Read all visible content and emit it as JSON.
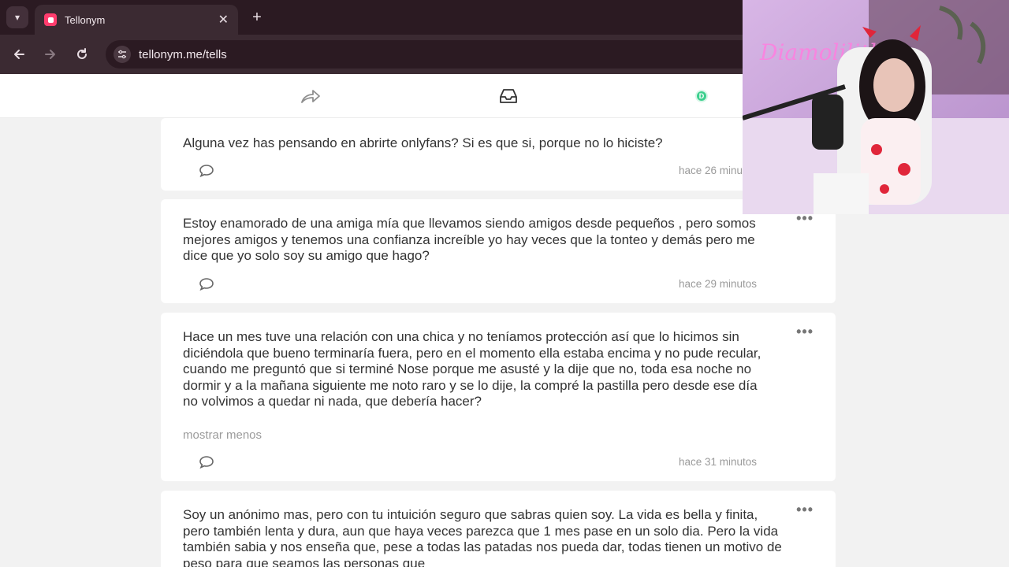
{
  "browser": {
    "tab_title": "Tellonym",
    "tab_close": "✕",
    "new_tab": "+",
    "url": "tellonym.me/tells"
  },
  "header": {
    "profile_initial": "D"
  },
  "tells": [
    {
      "text": "Alguna vez has pensando en abrirte onlyfans? Si es que si, porque no lo hiciste?",
      "time": "hace 26 minutos"
    },
    {
      "text": "Estoy enamorado de una amiga mía que llevamos siendo amigos desde pequeños , pero somos mejores amigos y tenemos una confianza increíble yo hay veces que la tonteo y demás pero me dice que yo solo soy su amigo que hago?",
      "time": "hace 29 minutos",
      "menu": "•••"
    },
    {
      "text": "Hace un mes tuve una relación con una chica y no teníamos protección así que lo hicimos sin diciéndola que bueno terminaría fuera, pero en el momento ella estaba encima y no pude recular, cuando me preguntó que si terminé Nose porque me asusté y la dije que no, toda esa noche no dormir y a la mañana siguiente me noto raro y se lo dije, la compré la pastilla pero desde ese día no volvimos a quedar ni nada, que debería hacer?",
      "more": "mostrar menos",
      "time": "hace 31 minutos",
      "menu": "•••"
    },
    {
      "text": "Soy un anónimo mas, pero con tu intuición seguro que sabras quien soy. La vida es bella y finita, pero también lenta y dura, aun que haya veces parezca que 1 mes pase en un solo dia. Pero la vida también sabia y nos enseña que, pese a todas las patadas nos pueda dar, todas tienen un motivo de peso para que seamos las personas que",
      "menu": "•••"
    }
  ],
  "webcam": {
    "overlay_text": "Diamolilith",
    "colors": {
      "wall": "#c9a6da",
      "neon": "#ff5fd2",
      "chair": "#f4f4f4"
    }
  },
  "colors": {
    "tab_bar": "#2b1a22",
    "toolbar": "#3b2a32",
    "accent": "#ff3d6e",
    "page_bg": "#f2f2f2",
    "profile_badge": "#3ccf8e"
  }
}
